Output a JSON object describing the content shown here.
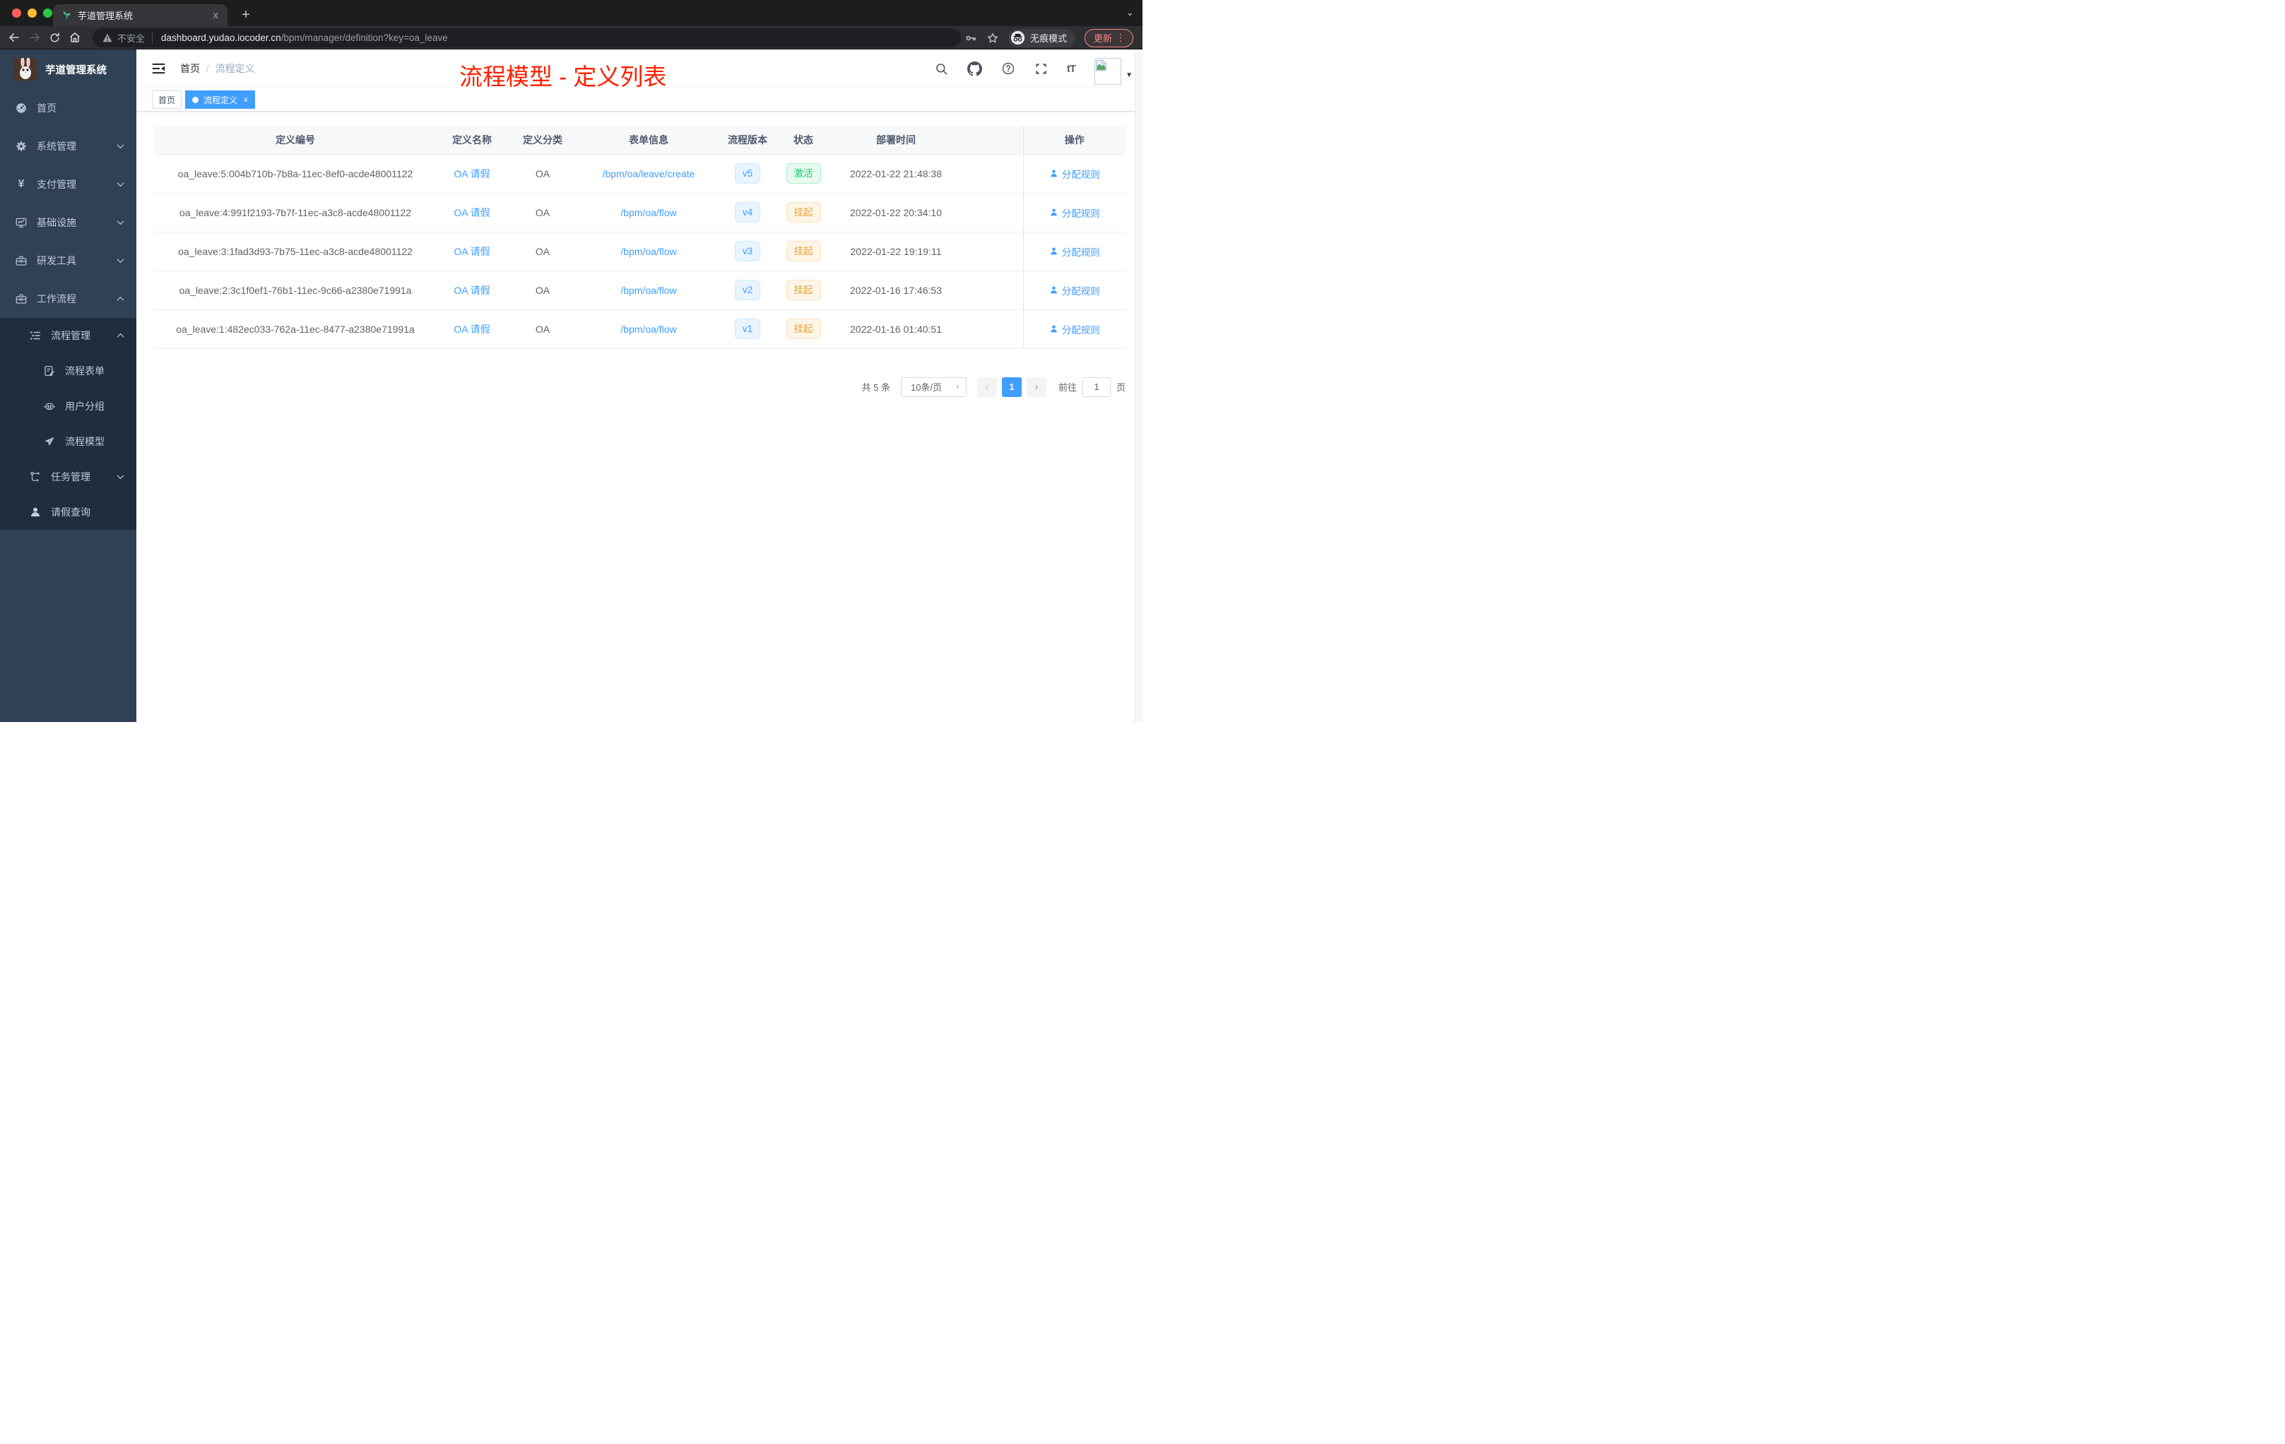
{
  "browser": {
    "tab_title": "芋道管理系统",
    "security_label": "不安全",
    "url_host": "dashboard.yudao.iocoder.cn",
    "url_path": "/bpm/manager/definition?key=oa_leave",
    "incognito_label": "无痕模式",
    "update_label": "更新"
  },
  "sidebar": {
    "app_title": "芋道管理系统",
    "items": [
      {
        "label": "首页",
        "icon": "dashboard-icon"
      },
      {
        "label": "系统管理",
        "icon": "gear-icon",
        "chevron": "down"
      },
      {
        "label": "支付管理",
        "icon": "yen-icon",
        "chevron": "down"
      },
      {
        "label": "基础设施",
        "icon": "monitor-icon",
        "chevron": "down"
      },
      {
        "label": "研发工具",
        "icon": "toolbox-icon",
        "chevron": "down"
      },
      {
        "label": "工作流程",
        "icon": "briefcase-icon",
        "chevron": "up"
      },
      {
        "label": "流程管理",
        "icon": "list-icon",
        "chevron": "up"
      },
      {
        "label": "流程表单",
        "icon": "form-icon"
      },
      {
        "label": "用户分组",
        "icon": "robot-icon"
      },
      {
        "label": "流程模型",
        "icon": "send-icon"
      },
      {
        "label": "任务管理",
        "icon": "tree-icon",
        "chevron": "down"
      },
      {
        "label": "请假查询",
        "icon": "user-icon"
      }
    ]
  },
  "header": {
    "breadcrumb": {
      "home": "首页",
      "separator": "/",
      "current": "流程定义"
    },
    "annotation": "流程模型 - 定义列表",
    "font_size_icon_text": "tT"
  },
  "tags": [
    {
      "label": "首页",
      "active": false
    },
    {
      "label": "流程定义",
      "active": true
    }
  ],
  "table": {
    "columns": [
      "定义编号",
      "定义名称",
      "定义分类",
      "表单信息",
      "流程版本",
      "状态",
      "部署时间",
      "操作"
    ],
    "rows": [
      {
        "id": "oa_leave:5:004b710b-7b8a-11ec-8ef0-acde48001122",
        "name": "OA 请假",
        "category": "OA",
        "form": "/bpm/oa/leave/create",
        "version": "v5",
        "status": "激活",
        "time": "2022-01-22 21:48:38",
        "action": "分配规则"
      },
      {
        "id": "oa_leave:4:991f2193-7b7f-11ec-a3c8-acde48001122",
        "name": "OA 请假",
        "category": "OA",
        "form": "/bpm/oa/flow",
        "version": "v4",
        "status": "挂起",
        "time": "2022-01-22 20:34:10",
        "action": "分配规则"
      },
      {
        "id": "oa_leave:3:1fad3d93-7b75-11ec-a3c8-acde48001122",
        "name": "OA 请假",
        "category": "OA",
        "form": "/bpm/oa/flow",
        "version": "v3",
        "status": "挂起",
        "time": "2022-01-22 19:19:11",
        "action": "分配规则"
      },
      {
        "id": "oa_leave:2:3c1f0ef1-76b1-11ec-9c66-a2380e71991a",
        "name": "OA 请假",
        "category": "OA",
        "form": "/bpm/oa/flow",
        "version": "v2",
        "status": "挂起",
        "time": "2022-01-16 17:46:53",
        "action": "分配规则"
      },
      {
        "id": "oa_leave:1:482ec033-762a-11ec-8477-a2380e71991a",
        "name": "OA 请假",
        "category": "OA",
        "form": "/bpm/oa/flow",
        "version": "v1",
        "status": "挂起",
        "time": "2022-01-16 01:40:51",
        "action": "分配规则"
      }
    ]
  },
  "pagination": {
    "total": "共 5 条",
    "page_size": "10条/页",
    "page": "1",
    "goto_label": "前往",
    "page_suffix": "页"
  },
  "colors": {
    "accent_blue": "#409eff",
    "annotation_red": "#ff2000",
    "success_green": "#13ce66",
    "warning_orange": "#e6a23c",
    "sidebar_bg": "#304156",
    "submenu_bg": "#1f2d3d"
  },
  "glyphs": {
    "yen": "¥",
    "close": "×",
    "plus": "+",
    "kebab": "⋮",
    "caret_down": "▼",
    "chevron_down": "⌄",
    "select_caret": "∨",
    "prev": "‹",
    "next": "›",
    "tab_close": "x"
  }
}
